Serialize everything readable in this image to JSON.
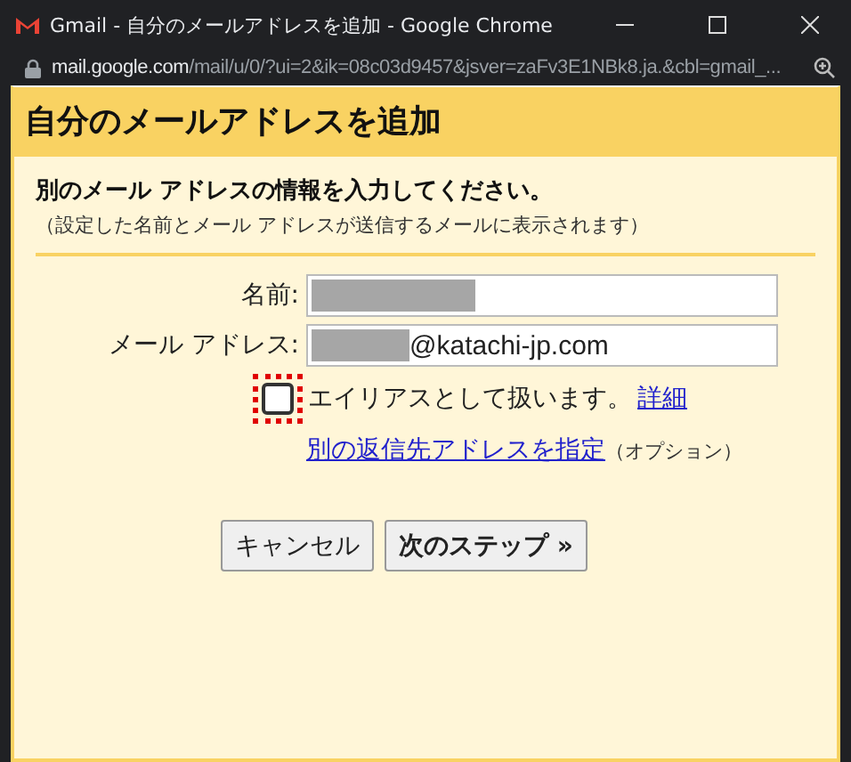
{
  "window": {
    "title": "Gmail - 自分のメールアドレスを追加 - Google Chrome",
    "url_domain": "mail.google.com",
    "url_path": "/mail/u/0/?ui=2&ik=08c03d9457&jsver=zaFv3E1NBk8.ja.&cbl=gmail_..."
  },
  "dialog": {
    "title": "自分のメールアドレスを追加",
    "heading": "別のメール アドレスの情報を入力してください。",
    "subheading": "（設定した名前とメール アドレスが送信するメールに表示されます）",
    "fields": [
      {
        "label": "名前:"
      },
      {
        "label": "メール アドレス:",
        "value": "@katachi-jp.com"
      }
    ],
    "alias": {
      "label": "エイリアスとして扱います。",
      "link": "詳細",
      "checked": false
    },
    "reply_to": {
      "link": "別の返信先アドレスを指定",
      "note": "（オプション）"
    },
    "buttons": [
      {
        "label": "キャンセル",
        "kind": "normal"
      },
      {
        "label": "次のステップ »",
        "kind": "primary"
      }
    ]
  }
}
